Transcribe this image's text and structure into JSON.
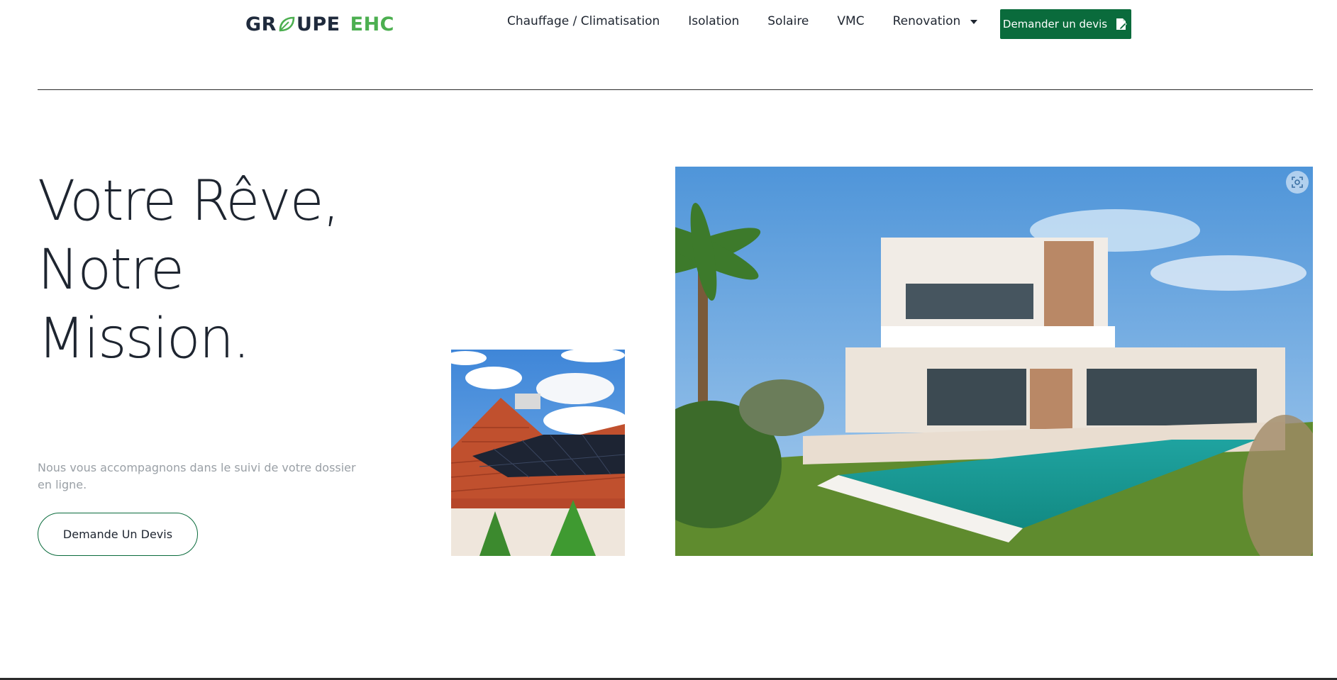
{
  "header": {
    "logo": {
      "part1_a": "GR",
      "part1_b": "UPE",
      "part2": "EHC"
    },
    "nav": [
      {
        "label": "Chauffage / Climatisation"
      },
      {
        "label": "Isolation"
      },
      {
        "label": "Solaire"
      },
      {
        "label": "VMC"
      },
      {
        "label": "Renovation",
        "has_dropdown": true
      }
    ],
    "cta_label": "Demander un devis"
  },
  "hero": {
    "title_line1": "Votre Rêve, Notre",
    "title_line2": "Mission.",
    "text": "Nous vous accompagnons dans le suivi de votre dossier en ligne.",
    "button_label": "Demande Un Devis"
  },
  "icons": {
    "logo_leaf": "leaf-icon",
    "dropdown": "chevron-down-icon",
    "cta": "document-edit-icon",
    "image_search": "lens-icon"
  },
  "colors": {
    "brand_green": "#0a6b3c",
    "logo_green": "#4caf50",
    "text_dark": "#1e2530",
    "text_muted": "#9aa0a6"
  }
}
